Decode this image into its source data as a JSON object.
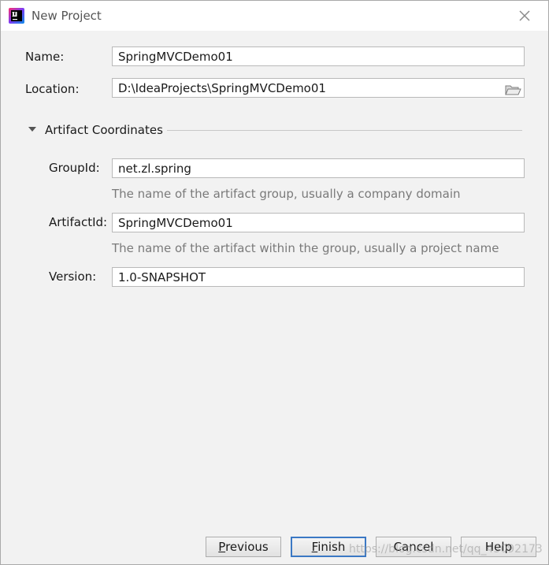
{
  "window": {
    "title": "New Project"
  },
  "icons": {
    "logo": "intellij-idea-logo-icon",
    "close": "close-icon",
    "folder": "folder-icon",
    "toggle": "triangle-down-icon"
  },
  "form": {
    "name_label": "Name:",
    "name_value": "SpringMVCDemo01",
    "location_label": "Location:",
    "location_value": "D:\\IdeaProjects\\SpringMVCDemo01"
  },
  "artifact": {
    "section_title": "Artifact Coordinates",
    "groupid_label": "GroupId:",
    "groupid_value": "net.zl.spring",
    "groupid_hint": "The name of the artifact group, usually a company domain",
    "artifactid_label": "ArtifactId:",
    "artifactid_value": "SpringMVCDemo01",
    "artifactid_hint": "The name of the artifact within the group, usually a project name",
    "version_label": "Version:",
    "version_value": "1.0-SNAPSHOT"
  },
  "buttons": {
    "previous_mnemonic": "P",
    "previous_rest": "revious",
    "finish_mnemonic": "F",
    "finish_rest": "inish",
    "cancel": "Cancel",
    "help": "Help"
  },
  "watermark": "https://blog.csdn.net/qq_43092173",
  "colors": {
    "default_button_border": "#3b78c4",
    "hint_text": "#7a7a7a",
    "dialog_background": "#f2f2f2"
  }
}
